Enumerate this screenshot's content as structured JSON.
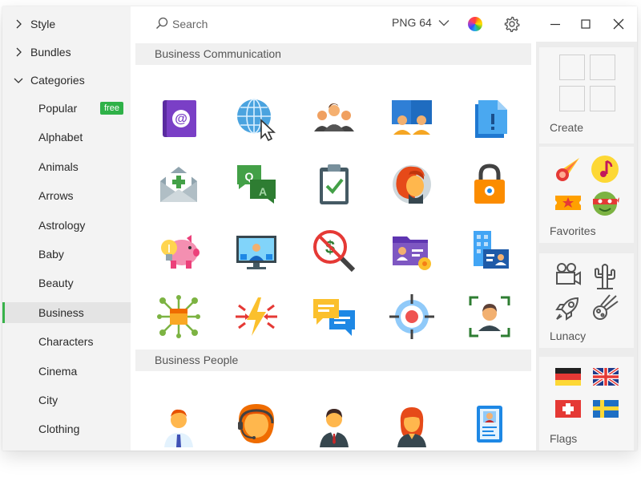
{
  "sidebar": {
    "top_items": [
      {
        "label": "Style",
        "expanded": false
      },
      {
        "label": "Bundles",
        "expanded": false
      },
      {
        "label": "Categories",
        "expanded": true
      }
    ],
    "categories": [
      {
        "label": "Popular",
        "badge": "free"
      },
      {
        "label": "Alphabet"
      },
      {
        "label": "Animals"
      },
      {
        "label": "Arrows"
      },
      {
        "label": "Astrology"
      },
      {
        "label": "Baby"
      },
      {
        "label": "Beauty"
      },
      {
        "label": "Business",
        "active": true
      },
      {
        "label": "Characters"
      },
      {
        "label": "Cinema"
      },
      {
        "label": "City"
      },
      {
        "label": "Clothing"
      }
    ]
  },
  "toolbar": {
    "search_placeholder": "Search",
    "format_label": "PNG 64",
    "icons": [
      "search-icon",
      "chevron-down-icon",
      "color-wheel-icon",
      "gear-icon"
    ]
  },
  "window_controls": [
    "minimize-icon",
    "maximize-icon",
    "close-icon"
  ],
  "main": {
    "sections": [
      {
        "title": "Business Communication",
        "icons": [
          "email-address-book-icon",
          "web-globe-cursor-icon",
          "meeting-group-icon",
          "video-conference-icon",
          "document-exclamation-icon",
          "envelope-add-icon",
          "qa-chat-icon",
          "checklist-clipboard-icon",
          "profile-face-icon",
          "padlock-icon",
          "piggy-bank-idea-icon",
          "video-call-monitor-icon",
          "no-money-search-icon",
          "business-folder-icon",
          "id-badge-building-icon",
          "network-box-icon",
          "conflict-lightning-icon",
          "chat-bubbles-icon",
          "target-icon",
          "face-scan-icon"
        ]
      },
      {
        "title": "Business People",
        "icons": [
          "businessman-icon",
          "support-agent-icon",
          "manager-icon",
          "businesswoman-icon",
          "id-card-icon"
        ]
      }
    ]
  },
  "right_panel": {
    "cards": [
      {
        "title": "Create",
        "icons": [
          "empty-slot-icon",
          "empty-slot-icon",
          "empty-slot-icon",
          "empty-slot-icon"
        ]
      },
      {
        "title": "Favorites",
        "icons": [
          "comet-icon",
          "music-note-icon",
          "ticket-icon",
          "turtle-icon"
        ]
      },
      {
        "title": "Lunacy",
        "icons": [
          "movie-camera-icon",
          "cactus-icon",
          "rocket-icon",
          "meteor-icon"
        ]
      },
      {
        "title": "Flags",
        "icons": [
          "germany-flag-icon",
          "uk-flag-icon",
          "switzerland-flag-icon",
          "sweden-flag-icon"
        ]
      }
    ]
  },
  "colors": {
    "accent_green": "#2fb148",
    "sidebar_bg": "#f3f3f3",
    "section_header_bg": "#f0f0f0"
  }
}
